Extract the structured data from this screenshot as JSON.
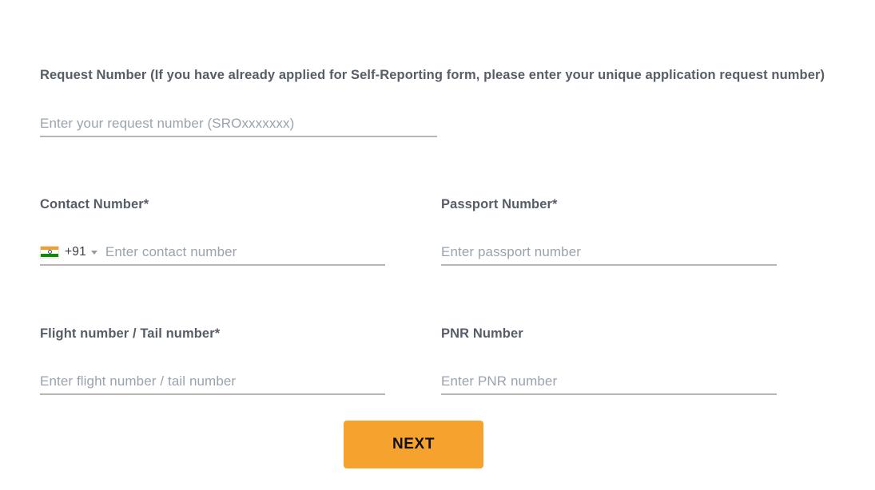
{
  "theme": {
    "background": "#ffffff",
    "label_color": "#575d67",
    "placeholder_color": "#9aa3ad",
    "underline_color": "#b6b6b6",
    "accent_button": "#f5a32e",
    "button_text": "#111111"
  },
  "form": {
    "fields": [
      {
        "id": "request-number",
        "label": "Request Number (If you have already applied for Self-Reporting form, please enter your unique application request number)",
        "placeholder": "Enter your request number (SROxxxxxxx)",
        "value": "",
        "required": false
      },
      {
        "id": "contact-number",
        "label": "Contact Number",
        "required_mark": "*",
        "placeholder": "Enter contact number",
        "value": "",
        "required": true,
        "country": {
          "flag": "india-flag-icon",
          "dial_code": "+91",
          "caret": "chevron-down-icon"
        }
      },
      {
        "id": "passport-number",
        "label": "Passport Number",
        "required_mark": "*",
        "placeholder": "Enter passport number",
        "value": "",
        "required": true
      },
      {
        "id": "flight-number",
        "label": "Flight number / Tail number",
        "required_mark": "*",
        "placeholder": "Enter flight number / tail number",
        "value": "",
        "required": true
      },
      {
        "id": "pnr-number",
        "label": "PNR Number",
        "required_mark": "",
        "placeholder": "Enter PNR number",
        "value": "",
        "required": false
      }
    ],
    "submit": {
      "label": "NEXT"
    }
  }
}
